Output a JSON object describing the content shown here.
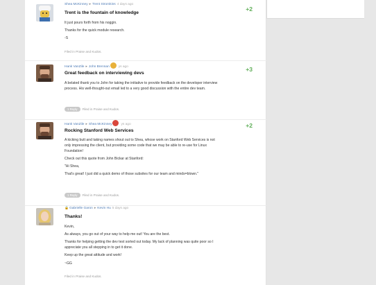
{
  "posts": [
    {
      "author": "Shea McKinney",
      "recipient": "Trent Stromkins",
      "time_ago": "4 days ago",
      "title": "Trent is the fountain of knowledge",
      "paragraphs": [
        "It just pours forth from his noggin.",
        "Thanks for the quick module research.",
        "-S"
      ],
      "reply_label": "",
      "filed_text": "Filed in Praise and Kudos.",
      "score": "+2"
    },
    {
      "author": "Hank VanZile",
      "recipient": "John Brennan",
      "time_ago": "ys ago",
      "title": "Great feedback on interviewing devs",
      "paragraphs": [
        "A belated thank you to John for taking the initiative to provide feedback on the developer interview process.  His well-thought-out email led to a very good discussion with the entire dev team."
      ],
      "reply_label": "1 Reply",
      "filed_text": "Filed in Praise and Kudos.",
      "score": "+3"
    },
    {
      "author": "Hank VanZile",
      "recipient": "Shea McKinney",
      "time_ago": "ys ago",
      "title": "Rocking Stanford Web Services",
      "paragraphs": [
        "A kicking butt and taking names shout out to Shea, whose work on Stanford Web Services is not only impressing the client, but providing some code that we may be able to re-use for Linux Foundation!",
        "Check out this quote from John Bickar at Stanford:",
        "\"Hi Shea,",
        "That's great! I just did a quick demo of those subsites for our team and minds=blown.\""
      ],
      "reply_label": "1 Reply",
      "filed_text": "Filed in Praise and Kudos.",
      "score": "+2"
    },
    {
      "author": "Gabrielle Garon",
      "recipient": "Kevin Hu",
      "time_ago": "5 days ago",
      "title": "Thanks!",
      "paragraphs": [
        "Kevin,",
        "As always, you go out of your way to help me out! You are the best.",
        "Thanks for helping getting the dev test sorted out today. My lack of planning was quite poor so I appreciate you all stepping in to get it done.",
        "Keep up the great attitude and work!",
        "~GG"
      ],
      "reply_label": "",
      "filed_text": "Filed in Praise and Kudos.",
      "score": ""
    }
  ]
}
